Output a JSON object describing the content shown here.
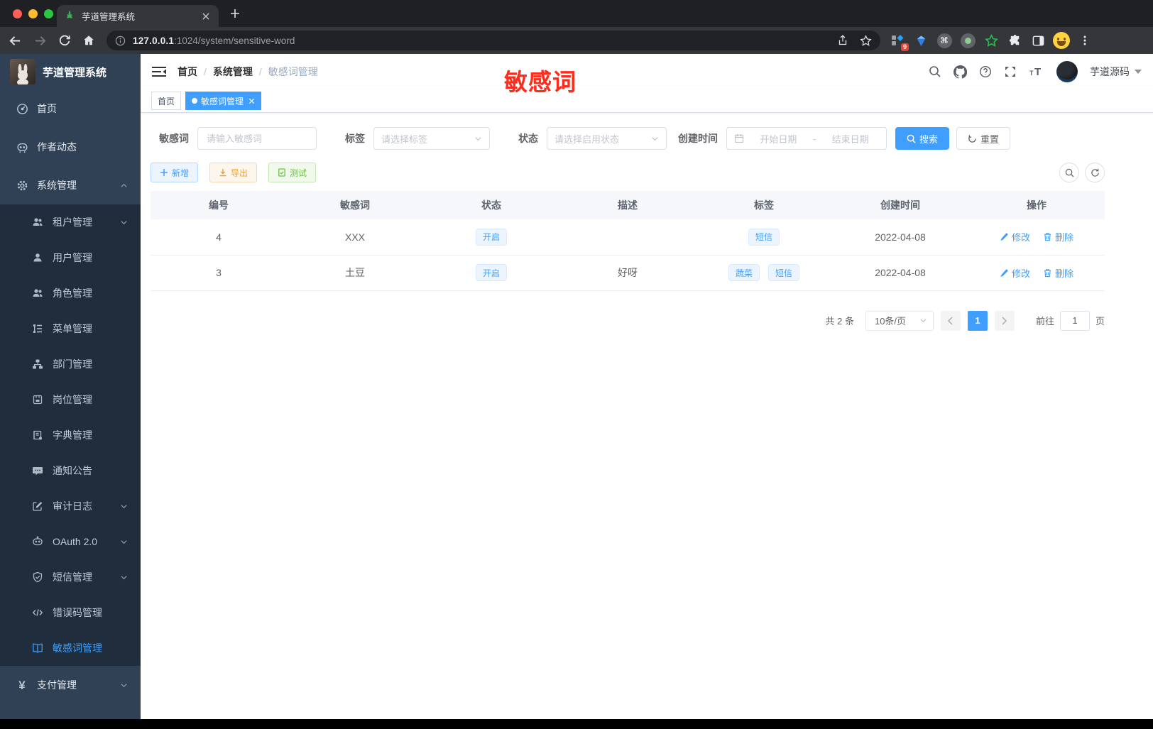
{
  "colors": {
    "primary": "#409eff",
    "warning": "#e6a23c",
    "success": "#67c23a",
    "annotation_red": "#fe2c1c",
    "sidebar_bg": "#304156",
    "submenu_bg": "#1f2d3d"
  },
  "browser": {
    "tab_title": "芋道管理系统",
    "url_host": "127.0.0.1",
    "url_path": ":1024/system/sensitive-word",
    "extension_badge": "9"
  },
  "sidebar": {
    "title": "芋道管理系统",
    "items": [
      {
        "label": "首页"
      },
      {
        "label": "作者动态"
      },
      {
        "label": "系统管理"
      },
      {
        "label": "租户管理"
      },
      {
        "label": "用户管理"
      },
      {
        "label": "角色管理"
      },
      {
        "label": "菜单管理"
      },
      {
        "label": "部门管理"
      },
      {
        "label": "岗位管理"
      },
      {
        "label": "字典管理"
      },
      {
        "label": "通知公告"
      },
      {
        "label": "审计日志"
      },
      {
        "label": "OAuth 2.0"
      },
      {
        "label": "短信管理"
      },
      {
        "label": "错误码管理"
      },
      {
        "label": "敏感词管理"
      },
      {
        "label": "支付管理"
      }
    ]
  },
  "navbar": {
    "breadcrumb": [
      {
        "label": "首页"
      },
      {
        "label": "系统管理"
      },
      {
        "label": "敏感词管理"
      }
    ],
    "separator": "/",
    "username": "芋道源码"
  },
  "tags_view": {
    "tabs": [
      {
        "label": "首页"
      },
      {
        "label": "敏感词管理"
      }
    ]
  },
  "annotation": {
    "text": "敏感词"
  },
  "filters": {
    "keyword_label": "敏感词",
    "keyword_placeholder": "请输入敏感词",
    "tag_label": "标签",
    "tag_placeholder": "请选择标签",
    "status_label": "状态",
    "status_placeholder": "请选择启用状态",
    "date_label": "创建时间",
    "date_start_placeholder": "开始日期",
    "date_separator": "-",
    "date_end_placeholder": "结束日期",
    "search_label": "搜索",
    "reset_label": "重置"
  },
  "toolbar": {
    "add_label": "新增",
    "export_label": "导出",
    "test_label": "测试"
  },
  "table": {
    "headers": [
      "编号",
      "敏感词",
      "状态",
      "描述",
      "标签",
      "创建时间",
      "操作"
    ],
    "rows": [
      {
        "id": "4",
        "word": "XXX",
        "status": "开启",
        "description": "",
        "tags": [
          "短信"
        ],
        "created_at": "2022-04-08"
      },
      {
        "id": "3",
        "word": "土豆",
        "status": "开启",
        "description": "好呀",
        "tags": [
          "蔬菜",
          "短信"
        ],
        "created_at": "2022-04-08"
      }
    ],
    "edit_label": "修改",
    "delete_label": "删除"
  },
  "pagination": {
    "total_text": "共 2 条",
    "page_size_text": "10条/页",
    "current_page": "1",
    "goto_label": "前往",
    "goto_value": "1",
    "page_unit": "页"
  }
}
